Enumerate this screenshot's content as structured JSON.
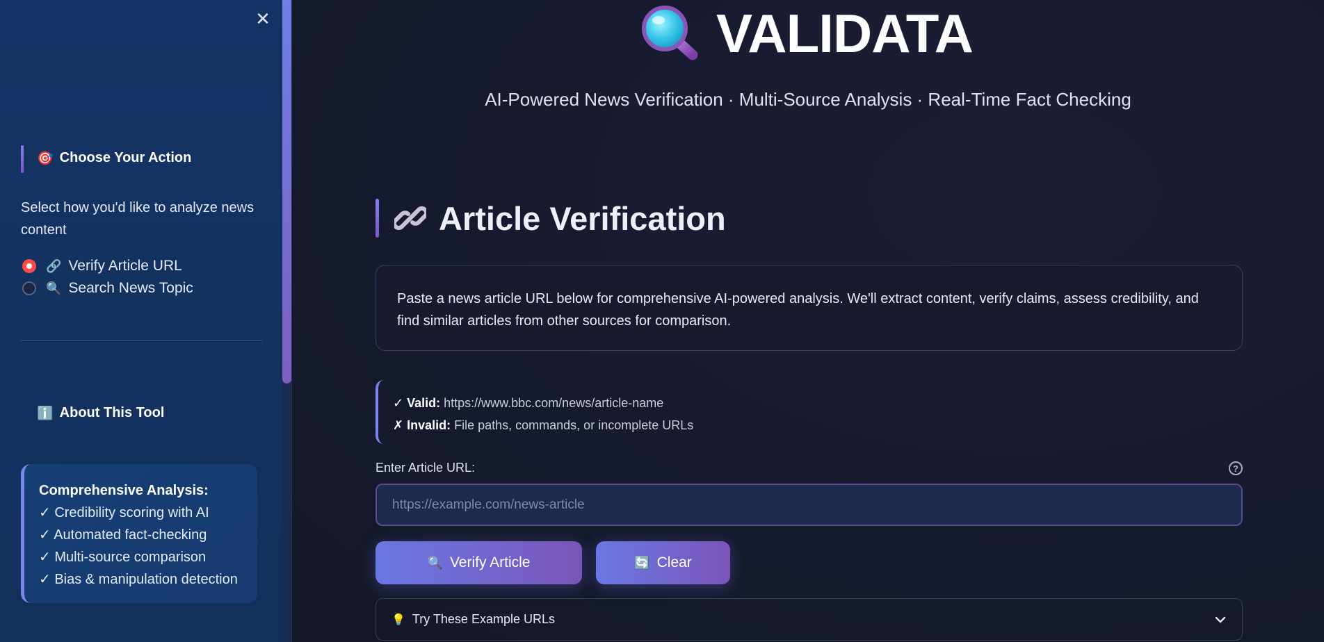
{
  "sidebar": {
    "choose_action": {
      "emoji": "🎯",
      "title": "Choose Your Action",
      "description": "Select how you'd like to analyze news content",
      "options": [
        {
          "emoji": "🔗",
          "label": "Verify Article URL",
          "selected": true
        },
        {
          "emoji": "🔍",
          "label": "Search News Topic",
          "selected": false
        }
      ]
    },
    "about": {
      "emoji": "ℹ️",
      "title": "About This Tool",
      "box_title": "Comprehensive Analysis:",
      "items": [
        "✓ Credibility scoring with AI",
        "✓ Automated fact-checking",
        "✓ Multi-source comparison",
        "✓ Bias & manipulation detection"
      ]
    }
  },
  "header": {
    "logo_text": "VALIDATA",
    "tagline": "AI-Powered News Verification · Multi-Source Analysis · Real-Time Fact Checking"
  },
  "main": {
    "title": "Article Verification",
    "description": "Paste a news article URL below for comprehensive AI-powered analysis. We'll extract content, verify claims, assess credibility, and find similar articles from other sources for comparison.",
    "hints": {
      "valid_label": "✓ Valid:",
      "valid_text": "https://www.bbc.com/news/article-name",
      "invalid_label": "✗ Invalid:",
      "invalid_text": "File paths, commands, or incomplete URLs"
    },
    "input": {
      "label": "Enter Article URL:",
      "placeholder": "https://example.com/news-article",
      "value": ""
    },
    "buttons": {
      "verify_emoji": "🔍",
      "verify_label": "Verify Article",
      "clear_emoji": "🔄",
      "clear_label": "Clear"
    },
    "examples": {
      "emoji": "💡",
      "label": "Try These Example URLs"
    }
  },
  "colors": {
    "accent_start": "#6a78e4",
    "accent_end": "#7a55b8",
    "radio_checked": "#ff4b4b",
    "sidebar_bg": "#143364",
    "main_bg": "#161a2e"
  }
}
